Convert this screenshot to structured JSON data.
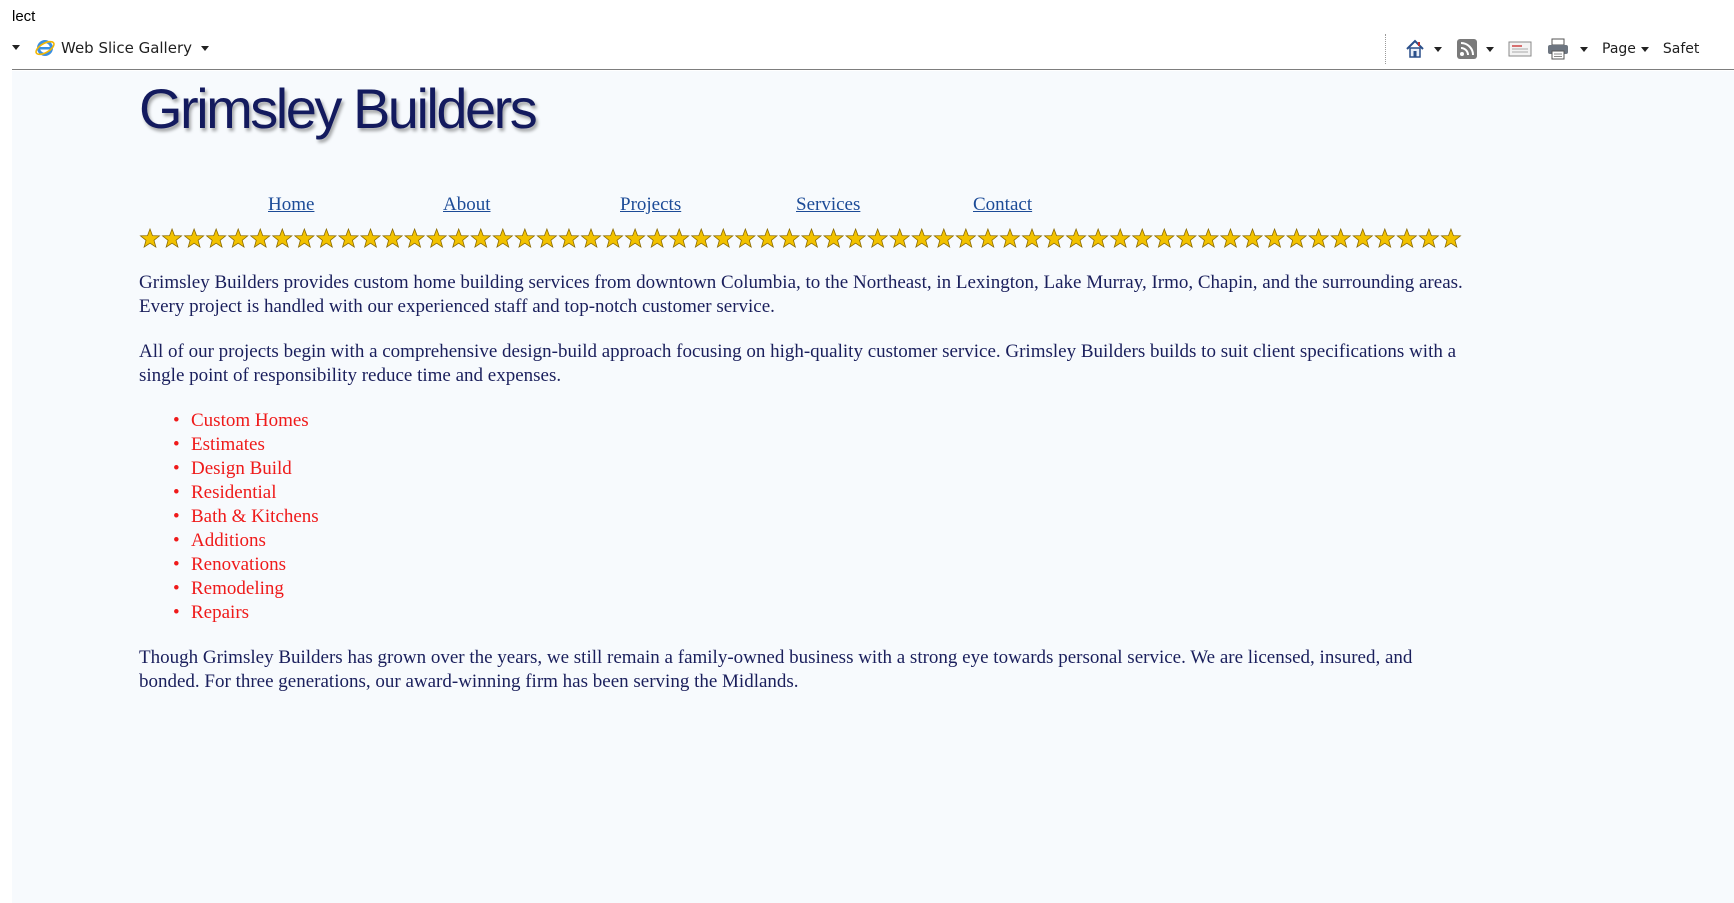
{
  "browser": {
    "top_fragment": "lect",
    "toolbar": {
      "web_slice_label": "Web Slice Gallery",
      "page_label": "Page",
      "safety_label": "Safet"
    }
  },
  "site": {
    "logo_text": "Grimsley Builders",
    "nav": [
      "Home",
      "About",
      "Projects",
      "Services",
      "Contact"
    ],
    "paragraphs": [
      "Grimsley Builders provides custom home building services from downtown Columbia, to the Northeast, in Lexington, Lake Murray, Irmo, Chapin, and the surrounding areas. Every project is handled with our experienced staff and top-notch customer service.",
      "All of our projects begin with a comprehensive design-build approach focusing on high-quality customer service. Grimsley Builders builds to suit client specifications with a single point of responsibility reduce time and expenses."
    ],
    "services": [
      "Custom Homes",
      "Estimates",
      "Design Build",
      "Residential",
      "Bath & Kitchens",
      "Additions",
      "Renovations",
      "Remodeling",
      "Repairs"
    ],
    "closing": "Though Grimsley Builders has grown over the years, we still remain a family-owned business with a strong eye towards personal service. We are licensed, insured, and bonded. For three generations, our award-winning firm has been serving the Midlands."
  },
  "colors": {
    "page_background": "#f7fafd",
    "logo": "#131a5e",
    "nav_link": "#1c4b97",
    "body_text": "#1a1f5c",
    "service_list": "#ef1a1a",
    "star_fill": "#f2c200"
  }
}
